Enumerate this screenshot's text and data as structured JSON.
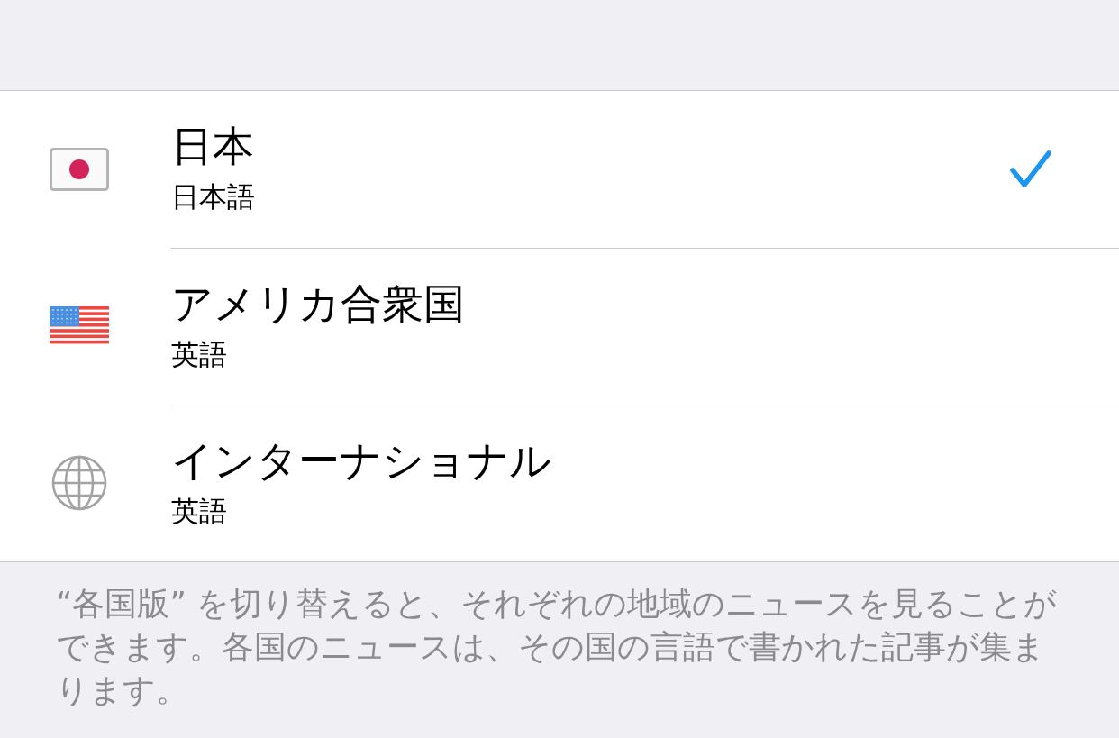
{
  "editions": [
    {
      "kind": "japan",
      "name": "日本",
      "language": "日本語",
      "selected": true
    },
    {
      "kind": "usa",
      "name": "アメリカ合衆国",
      "language": "英語",
      "selected": false
    },
    {
      "kind": "international",
      "name": "インターナショナル",
      "language": "英語",
      "selected": false
    }
  ],
  "footer": "“各国版” を切り替えると、それぞれの地域のニュースを見ることができます。各国のニュースは、その国の言語で書かれた記事が集まります。"
}
